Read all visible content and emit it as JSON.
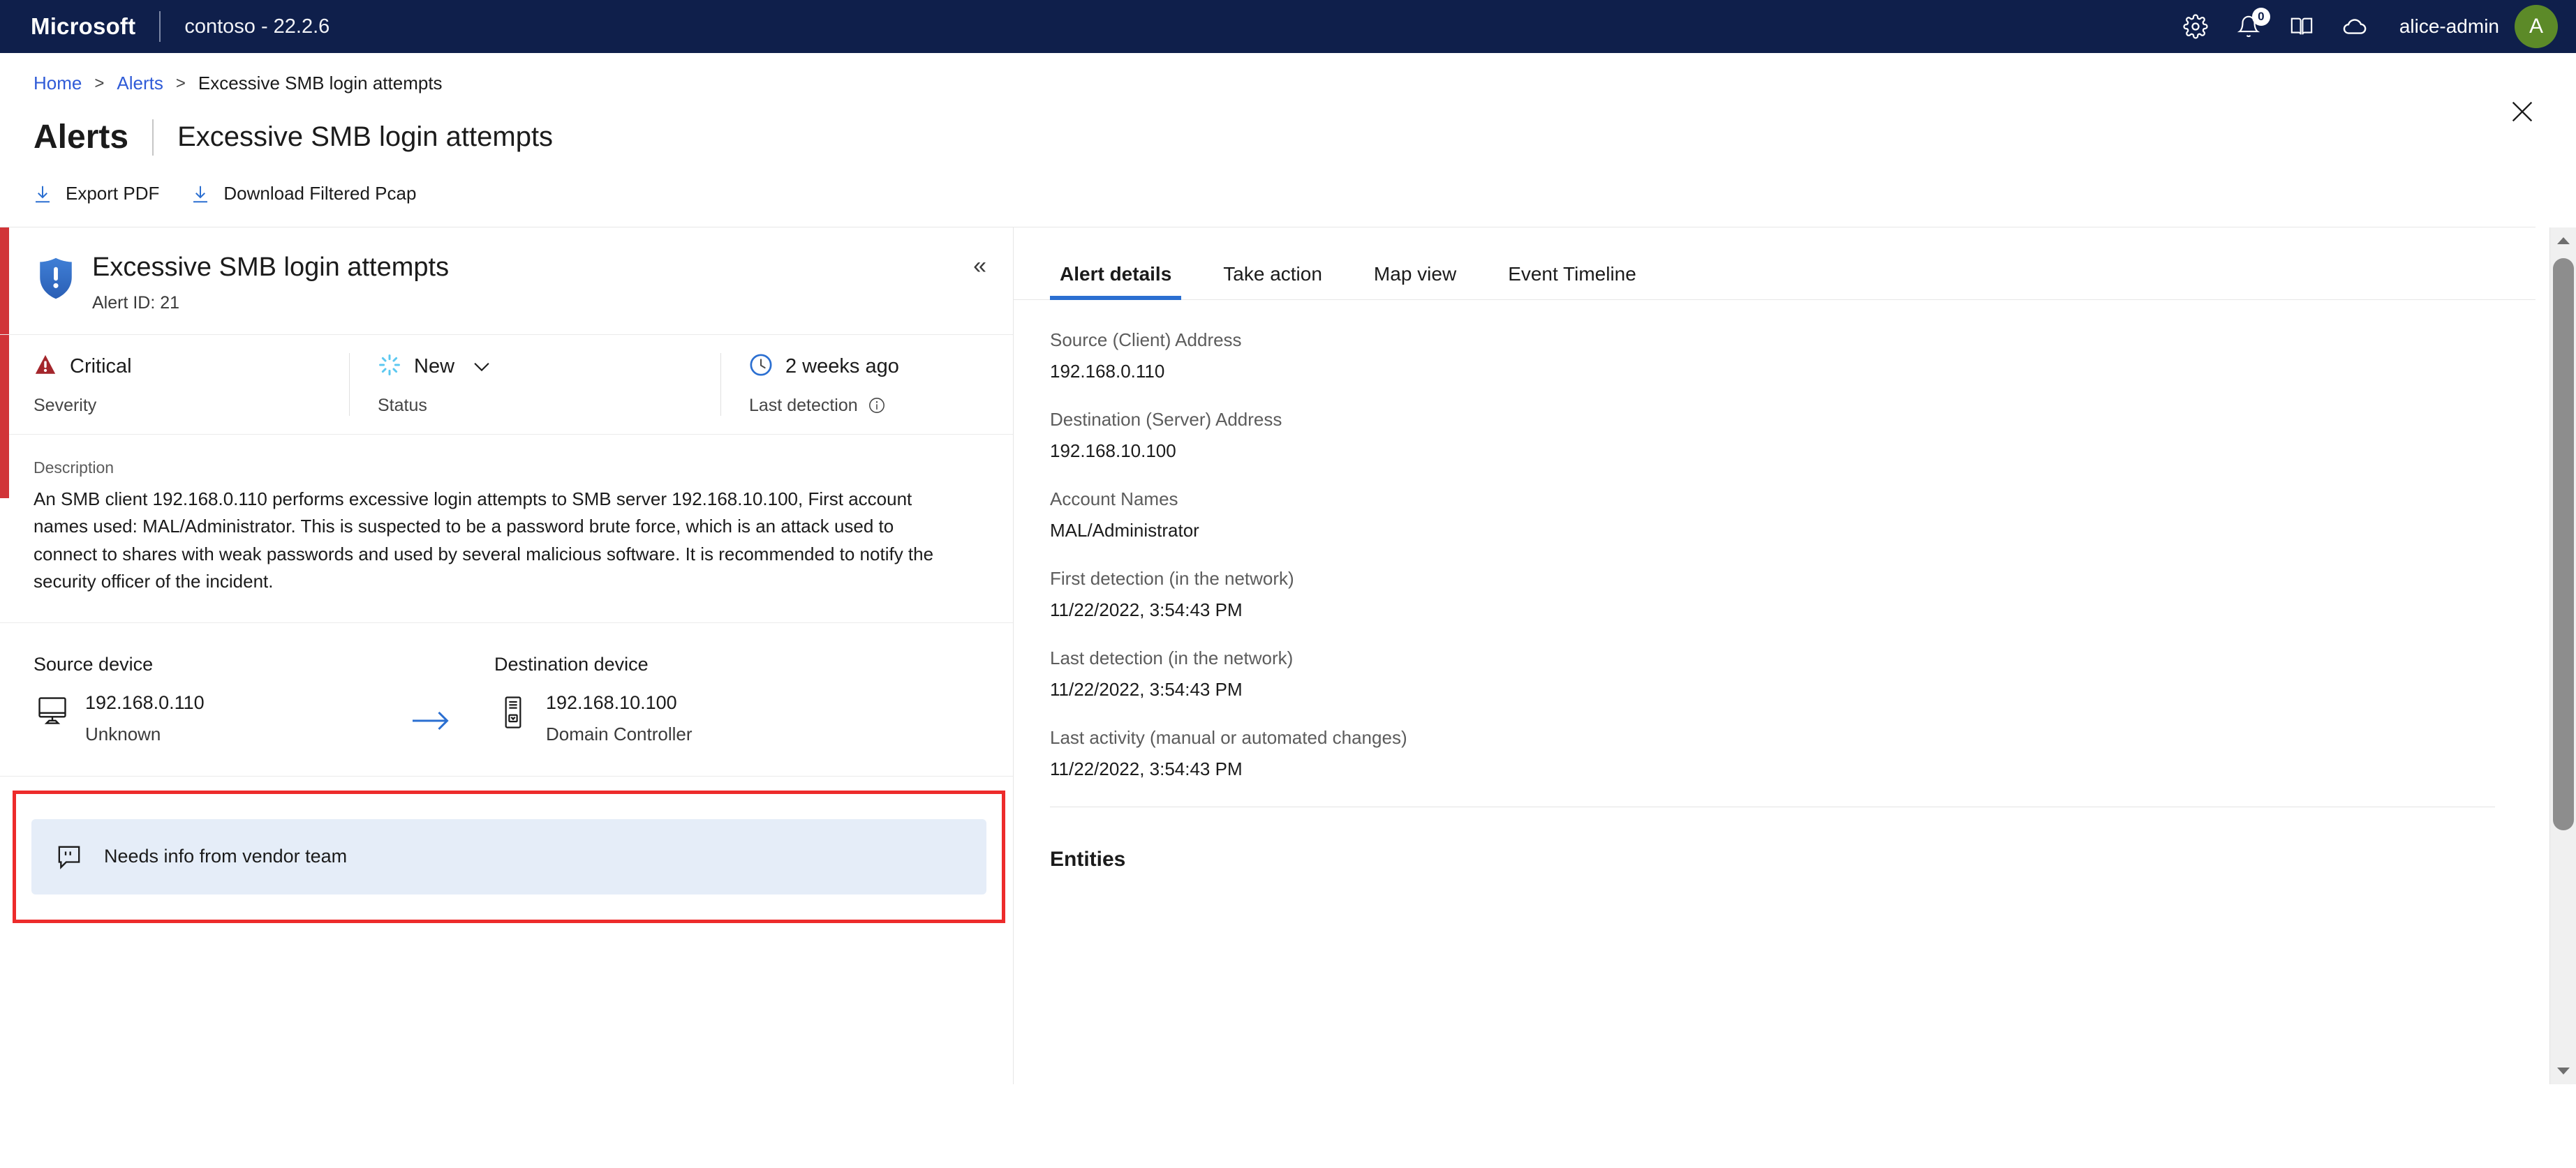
{
  "topbar": {
    "brand": "Microsoft",
    "tenant": "contoso - 22.2.6",
    "icons": [
      "gear-icon",
      "bell-icon",
      "book-icon",
      "cloud-icon"
    ],
    "notification_count": "0",
    "username": "alice-admin",
    "avatar_initial": "A",
    "avatar_color": "#5c8a28",
    "background": "#0f1f4b"
  },
  "breadcrumb": {
    "home": "Home",
    "alerts": "Alerts",
    "current": "Excessive SMB login attempts",
    "separator": ">"
  },
  "page": {
    "title": "Alerts",
    "subtitle": "Excessive SMB login attempts"
  },
  "commandbar": {
    "export_pdf": "Export PDF",
    "download_pcap": "Download Filtered Pcap"
  },
  "alert": {
    "title": "Excessive SMB login attempts",
    "alert_id": "Alert ID: 21",
    "severity_strip_color": "#d13438",
    "severity": {
      "value": "Critical",
      "label": "Severity",
      "color": "#a4262c"
    },
    "status": {
      "value": "New",
      "label": "Status",
      "color": "#5cc8f0"
    },
    "last_detection": {
      "value": "2 weeks ago",
      "label": "Last detection",
      "color": "#2b6fd1"
    },
    "description_label": "Description",
    "description": "An SMB client 192.168.0.110 performs excessive login attempts to SMB server 192.168.10.100, First account names used: MAL/Administrator. This is suspected to be a password brute force, which is an attack used to connect to shares with weak passwords and used by several malicious software. It is recommended to notify the security officer of the incident.",
    "source_device": {
      "header": "Source device",
      "ip": "192.168.0.110",
      "type": "Unknown"
    },
    "destination_device": {
      "header": "Destination device",
      "ip": "192.168.10.100",
      "type": "Domain Controller"
    },
    "comment": {
      "text": "Needs info from vendor team",
      "highlight_color": "#ed2b2b",
      "background": "#e5edf8"
    }
  },
  "right": {
    "tabs": [
      {
        "label": "Alert details",
        "active": true
      },
      {
        "label": "Take action",
        "active": false
      },
      {
        "label": "Map view",
        "active": false
      },
      {
        "label": "Event Timeline",
        "active": false
      }
    ],
    "details": [
      {
        "label": "Source (Client) Address",
        "value": "192.168.0.110"
      },
      {
        "label": "Destination (Server) Address",
        "value": "192.168.10.100"
      },
      {
        "label": "Account Names",
        "value": "MAL/Administrator"
      },
      {
        "label": "First detection (in the network)",
        "value": "11/22/2022, 3:54:43 PM"
      },
      {
        "label": "Last detection (in the network)",
        "value": "11/22/2022, 3:54:43 PM"
      },
      {
        "label": "Last activity (manual or automated changes)",
        "value": "11/22/2022, 3:54:43 PM"
      }
    ],
    "entities_header": "Entities"
  }
}
